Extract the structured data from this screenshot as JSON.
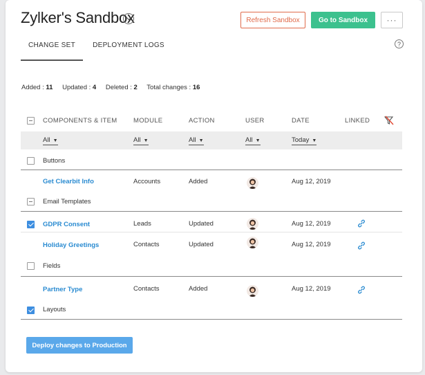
{
  "title": "Zylker's Sandbox",
  "buttons": {
    "refresh": "Refresh Sandbox",
    "goto": "Go to Sandbox",
    "more": "···",
    "deploy": "Deploy changes to Production"
  },
  "tabs": [
    "CHANGE SET",
    "DEPLOYMENT LOGS"
  ],
  "help": "?",
  "summary": {
    "added_label": "Added :",
    "added": "11",
    "updated_label": "Updated :",
    "updated": "4",
    "deleted_label": "Deleted :",
    "deleted": "2",
    "total_label": "Total changes :",
    "total": "16"
  },
  "columns": {
    "components": "COMPONENTS & ITEM",
    "module": "MODULE",
    "action": "ACTION",
    "user": "USER",
    "date": "DATE",
    "linked": "LINKED"
  },
  "filters": {
    "components": "All",
    "module": "All",
    "action": "All",
    "user": "All",
    "date": "Today"
  },
  "groups": {
    "buttons": "Buttons",
    "email_templates": "Email Templates",
    "fields": "Fields",
    "layouts": "Layouts"
  },
  "rows": [
    {
      "name": "Get Clearbit Info",
      "module": "Accounts",
      "action": "Added",
      "date": "Aug 12, 2019"
    },
    {
      "name": "GDPR Consent",
      "module": "Leads",
      "action": "Updated",
      "date": "Aug 12, 2019"
    },
    {
      "name": "Holiday Greetings",
      "module": "Contacts",
      "action": "Updated",
      "date": "Aug 12, 2019"
    },
    {
      "name": "Partner Type",
      "module": "Contacts",
      "action": "Added",
      "date": "Aug 12, 2019"
    }
  ],
  "colors": {
    "accent_green": "#3cc18e",
    "refresh_orange": "#e06a4a",
    "link_blue": "#2a8bd1",
    "deploy_blue": "#5aa8ea",
    "checkbox_blue": "#3d8ee0"
  }
}
